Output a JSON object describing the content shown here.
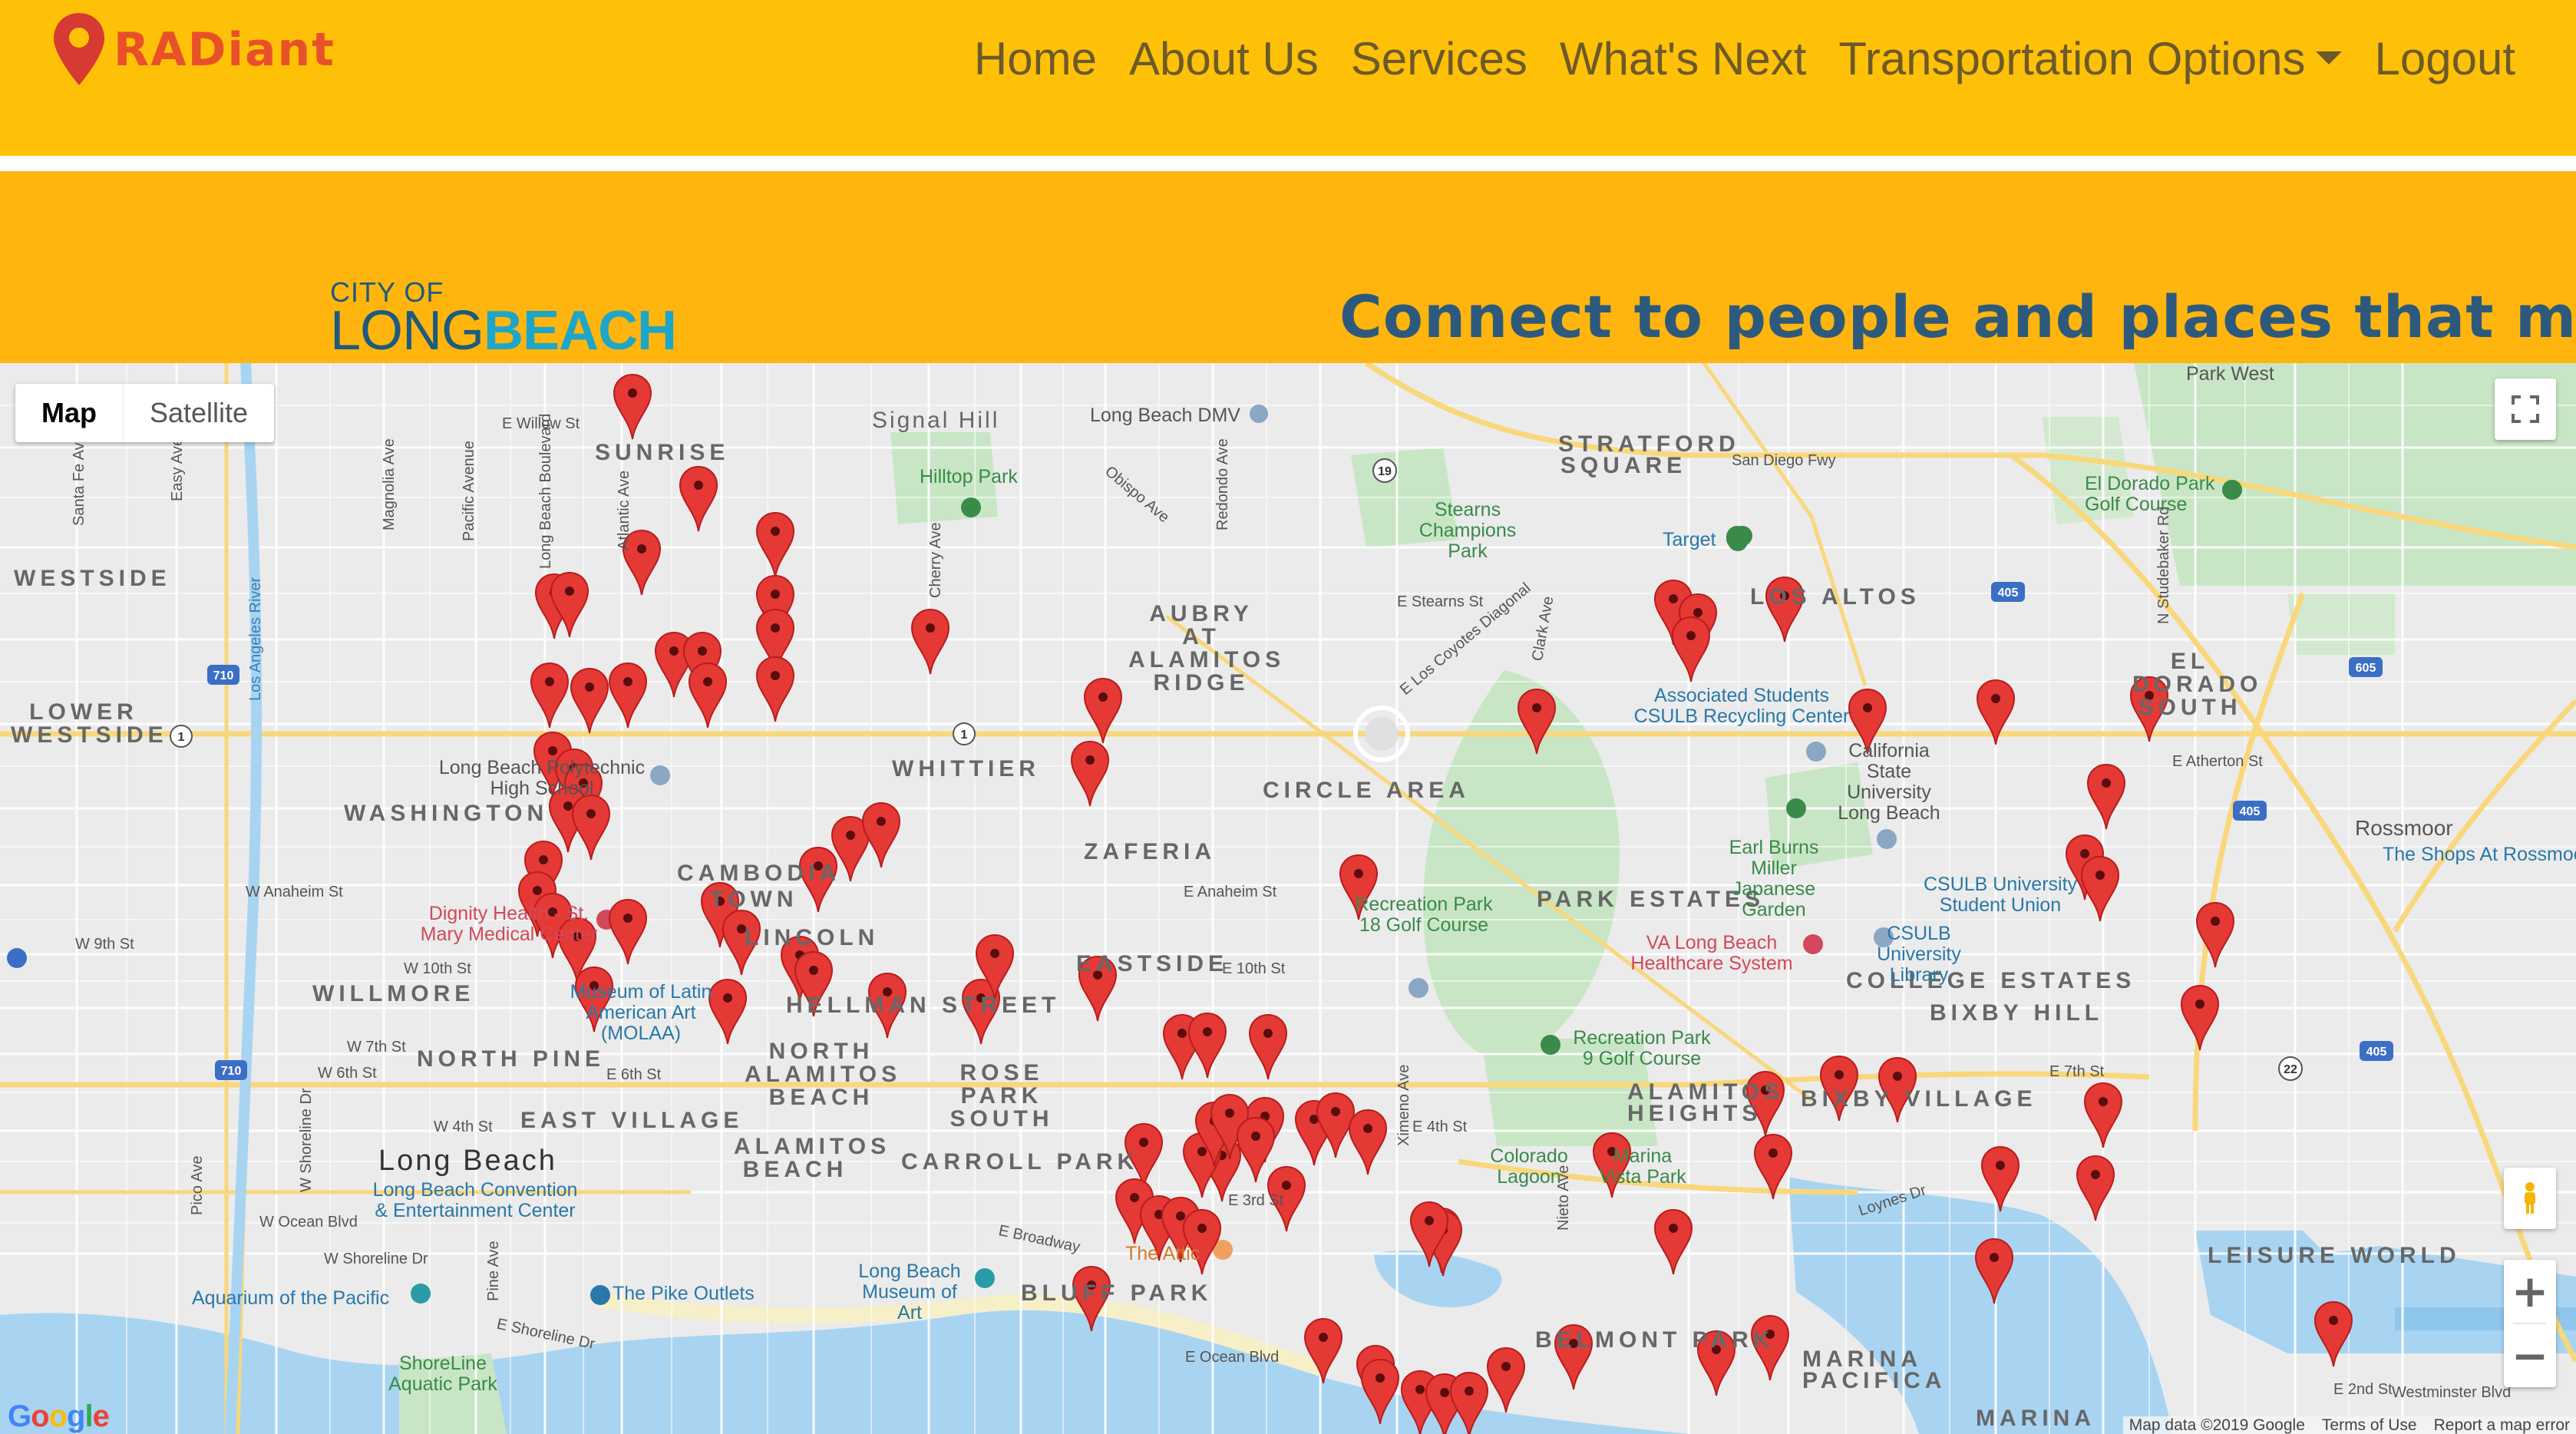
{
  "brand": {
    "name": "RADiant"
  },
  "nav": {
    "items": [
      "Home",
      "About Us",
      "Services",
      "What's Next",
      "Transportation Options",
      "Logout"
    ]
  },
  "banner": {
    "city_logo_small": "CITY OF",
    "city_logo_long": "LONG",
    "city_logo_beach": "BEACH",
    "tagline": "Connect to people and places that matte"
  },
  "map": {
    "type_control": {
      "map": "Map",
      "satellite": "Satellite"
    },
    "zoom_in": "+",
    "zoom_out": "−",
    "google_logo": "Google",
    "attribution": {
      "data": "Map data ©2019 Google",
      "terms": "Terms of Use",
      "report": "Report a map error"
    },
    "colors": {
      "pin": "#e53935",
      "water": "#a8d4f2",
      "park": "#c8e6c5",
      "highway": "#f9d77b",
      "land": "#ebebeb"
    },
    "neighborhoods": [
      "SUNRISE",
      "Signal Hill",
      "WESTSIDE",
      "LOWER WESTSIDE",
      "WASHINGTON",
      "WILLMORE",
      "NORTH PINE",
      "EAST VILLAGE",
      "WHITTIER",
      "ZAFERIA",
      "CAMBODIA TOWN",
      "LINCOLN",
      "HELLMAN STREET",
      "NORTH ALAMITOS BEACH",
      "ROSE PARK SOUTH",
      "EASTSIDE",
      "CARROLL PARK",
      "BLUFF PARK",
      "ALAMITOS BEACH",
      "AUBRY AT ALAMITOS RIDGE",
      "CIRCLE AREA",
      "PARK ESTATES",
      "STRATFORD SQUARE",
      "LOS ALTOS",
      "EL DORADO SOUTH",
      "COLLEGE ESTATES",
      "BIXBY HILL",
      "BIXBY VILLAGE",
      "ALAMITOS HEIGHTS",
      "BELMONT PARK",
      "MARINA PACIFICA",
      "LEISURE WORLD",
      "MARINA",
      "Long Beach",
      "Rossmoor",
      "Park West"
    ],
    "streets": [
      "E Willow St",
      "San Diego Fwy",
      "E Stearns St",
      "E Atherton St",
      "W Anaheim St",
      "E Anaheim St",
      "W 10th St",
      "E 10th St",
      "W 9th St",
      "W 7th St",
      "E 7th St",
      "W 6th St",
      "E 6th St",
      "W 4th St",
      "E 4th St",
      "E 3rd St",
      "W Ocean Blvd",
      "E Ocean Blvd",
      "E Broadway",
      "W Shoreline Dr",
      "E Shoreline Dr",
      "E 2nd St",
      "Loynes Dr",
      "Westminster Blvd",
      "Santa Fe Ave",
      "Easy Ave",
      "Magnolia Ave",
      "Pacific Avenue",
      "Long Beach Boulevard",
      "Atlantic Ave",
      "Cherry Ave",
      "Obispo Ave",
      "Redondo Ave",
      "Clark Ave",
      "E Los Coyotes Diagonal",
      "N Studebaker Rd",
      "Ximeno Ave",
      "Nieto Ave",
      "Pico Ave",
      "W Shoreline Dr",
      "Pine Ave",
      "Los Angeles River"
    ],
    "places": [
      "Hilltop Park",
      "Long Beach DMV",
      "Stearns Champions Park",
      "Target",
      "El Dorado Park Golf Course",
      "Long Beach Polytechnic High School",
      "Dignity Health - St. Mary Medical Center",
      "Museum of Latin American Art (MOLAA)",
      "Recreation Park 18 Golf Course",
      "Associated Students CSULB Recycling Center",
      "California State University Long Beach",
      "Earl Burns Miller Japanese Garden",
      "CSULB University Student Union",
      "CSULB University Library",
      "VA Long Beach Healthcare System",
      "Recreation Park 9 Golf Course",
      "Colorado Lagoon",
      "Marina Vista Park",
      "The Shops At Rossmoor",
      "Long Beach Convention & Entertainment Center",
      "Aquarium of the Pacific",
      "The Pike Outlets",
      "ShoreLine Aquatic Park",
      "Long Beach Museum of Art",
      "The Attic"
    ],
    "highway_shields": [
      "710",
      "1",
      "19",
      "405",
      "605",
      "22"
    ],
    "marker_count": 98
  }
}
